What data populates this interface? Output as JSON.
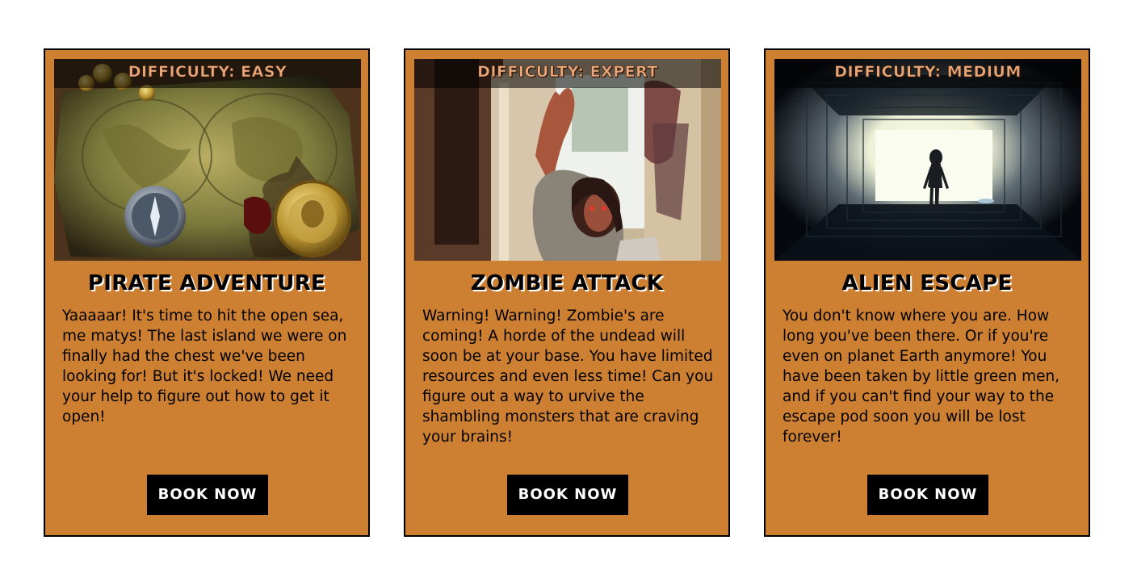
{
  "cards": [
    {
      "difficulty": "DIFFICULTY: EASY",
      "title": "PIRATE ADVENTURE",
      "description": "Yaaaaar! It's time to hit the open sea, me matys! The last island we were on finally had the chest we've been looking for! But it's locked! We need your help to figure out how to get it open!",
      "button_label": "BOOK NOW"
    },
    {
      "difficulty": "DIFFICULTY: EXPERT",
      "title": "ZOMBIE ATTACK",
      "description": "Warning! Warning! Zombie's are coming! A horde of the undead will soon be at your base. You have limited resources and even less time! Can you figure out a way to urvive the shambling monsters that are craving your brains!",
      "button_label": "BOOK NOW"
    },
    {
      "difficulty": "DIFFICULTY: MEDIUM",
      "title": "ALIEN ESCAPE",
      "description": "You don't know where you are. How long you've been there. Or if you're even on planet Earth anymore! You have been taken by little green men, and if you can't find your way to the escape pod soon you will be lost forever!",
      "button_label": "BOOK NOW"
    }
  ],
  "colors": {
    "card_background": "#cd7f32",
    "card_border": "#000000",
    "button_background": "#000000",
    "button_text": "#ffffff",
    "difficulty_text": "#e7a77a"
  }
}
